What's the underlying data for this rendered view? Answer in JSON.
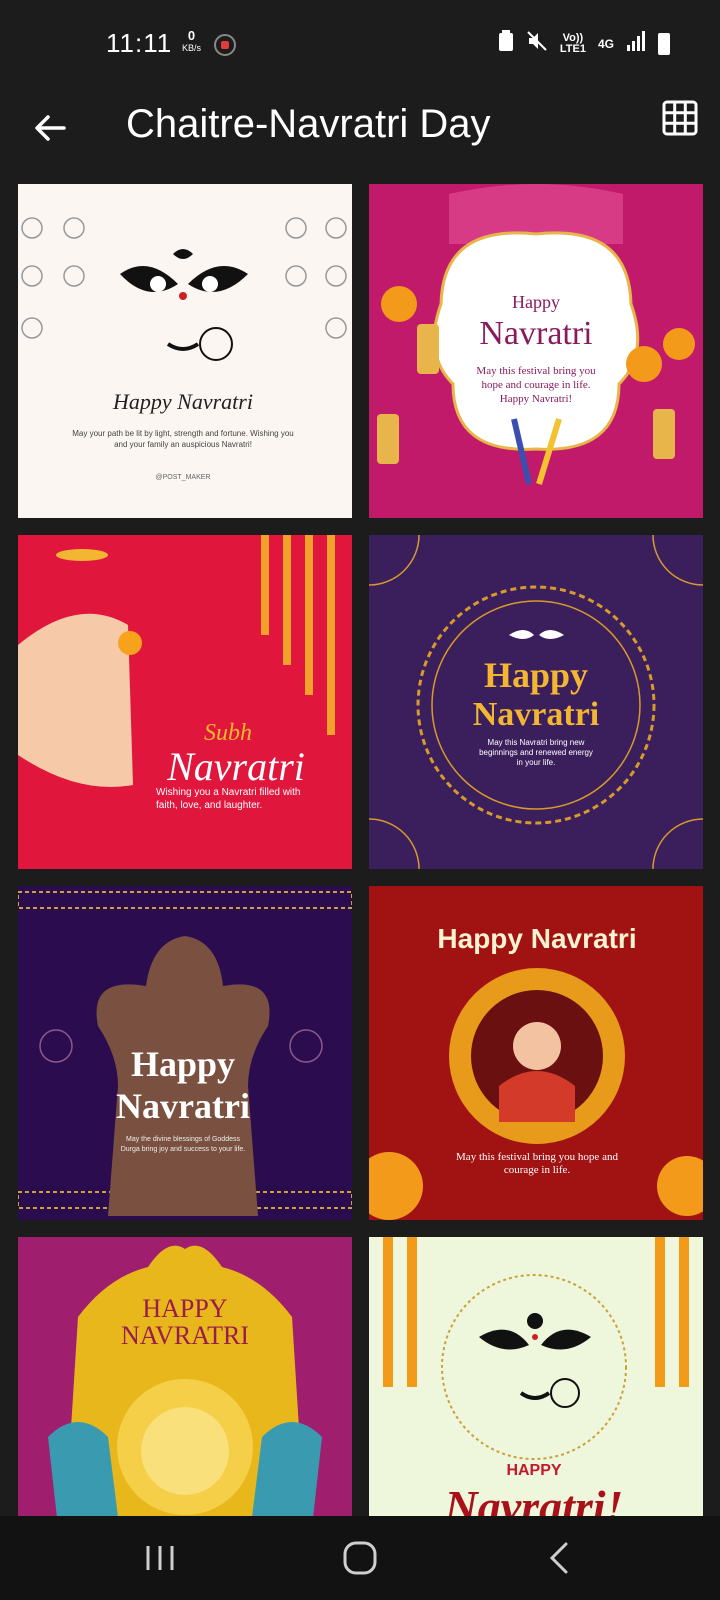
{
  "status": {
    "time": "11:11",
    "kb_value": "0",
    "kb_unit": "KB/s",
    "network": "4G",
    "lte": "LTE1",
    "volte": "Vo))"
  },
  "appbar": {
    "title": "Chaitre-Navratri Day"
  },
  "cards": [
    {
      "line1": "Happy Navratri",
      "line2": "May your path be lit by light, strength and fortune. Wishing you",
      "line3": "and your family an auspicious Navratri!",
      "credit": "@POST_MAKER"
    },
    {
      "line1": "Happy",
      "line2": "Navratri",
      "line3": "May this festival bring you",
      "line4": "hope and courage in life.",
      "line5": "Happy Navratri!"
    },
    {
      "line1": "Subh",
      "line2": "Navratri",
      "line3": "Wishing you a Navratri filled with",
      "line4": "faith, love, and laughter."
    },
    {
      "line1": "Happy",
      "line2": "Navratri",
      "line3": "May this Navratri bring new",
      "line4": "beginnings and renewed energy",
      "line5": "in your life."
    },
    {
      "line1": "Happy",
      "line2": "Navratri",
      "line3": "May the divine blessings of Goddess",
      "line4": "Durga bring joy and success to your life."
    },
    {
      "line1": "Happy Navratri",
      "line2": "May this festival bring you hope and",
      "line3": "courage in life."
    },
    {
      "line1": "HAPPY",
      "line2": "NAVRATRI"
    },
    {
      "line1": "HAPPY",
      "line2": "Navratri!"
    }
  ],
  "colors": {
    "bg": "#1c1c1c",
    "magenta": "#c21a6b",
    "red": "#e0163d",
    "purple": "#3b1f5c",
    "maroon": "#a11212",
    "gold": "#f2b632"
  }
}
